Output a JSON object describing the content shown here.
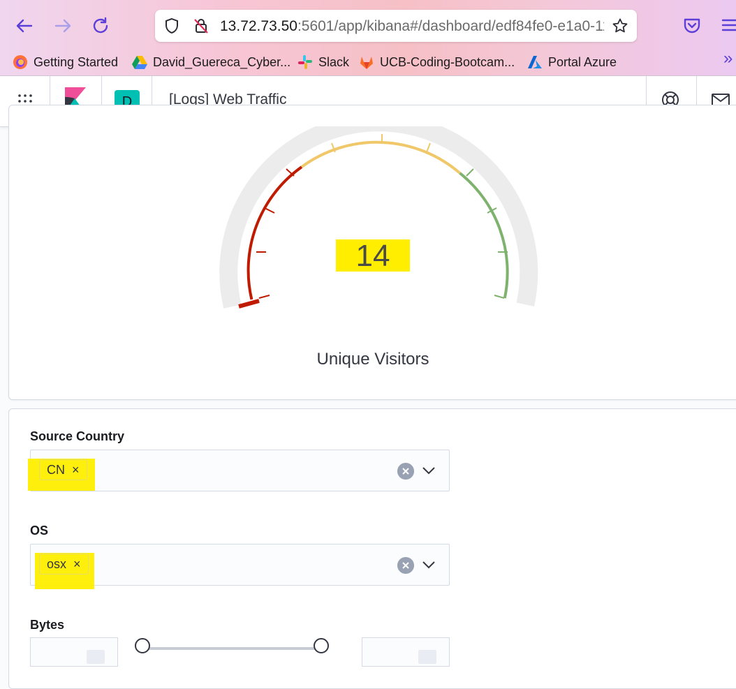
{
  "browser": {
    "url_host": "13.72.73.50",
    "url_rest": ":5601/app/kibana#/dashboard/edf84fe0-e1a0-11",
    "bookmarks": [
      {
        "label": "Getting Started",
        "icon": "firefox-icon"
      },
      {
        "label": "David_Guereca_Cyber...",
        "icon": "google-drive-icon"
      },
      {
        "label": "Slack",
        "icon": "slack-icon"
      },
      {
        "label": "UCB-Coding-Bootcam...",
        "icon": "gitlab-icon"
      },
      {
        "label": "Portal Azure",
        "icon": "azure-icon"
      }
    ],
    "overflow_label": "»"
  },
  "kibana": {
    "space_initial": "D",
    "dashboard_title": "[Logs] Web Traffic"
  },
  "gauge": {
    "value": "14",
    "label": "Unique Visitors",
    "colors": {
      "low": "#bf1b00",
      "mid": "#f0c86a",
      "high": "#7eb26d",
      "track": "#ececec",
      "highlight": "#ffee00"
    }
  },
  "controls": {
    "source_country": {
      "label": "Source Country",
      "selected": "CN",
      "remove_glyph": "×"
    },
    "os": {
      "label": "OS",
      "selected": "osx",
      "remove_glyph": "×"
    },
    "bytes": {
      "label": "Bytes"
    }
  }
}
